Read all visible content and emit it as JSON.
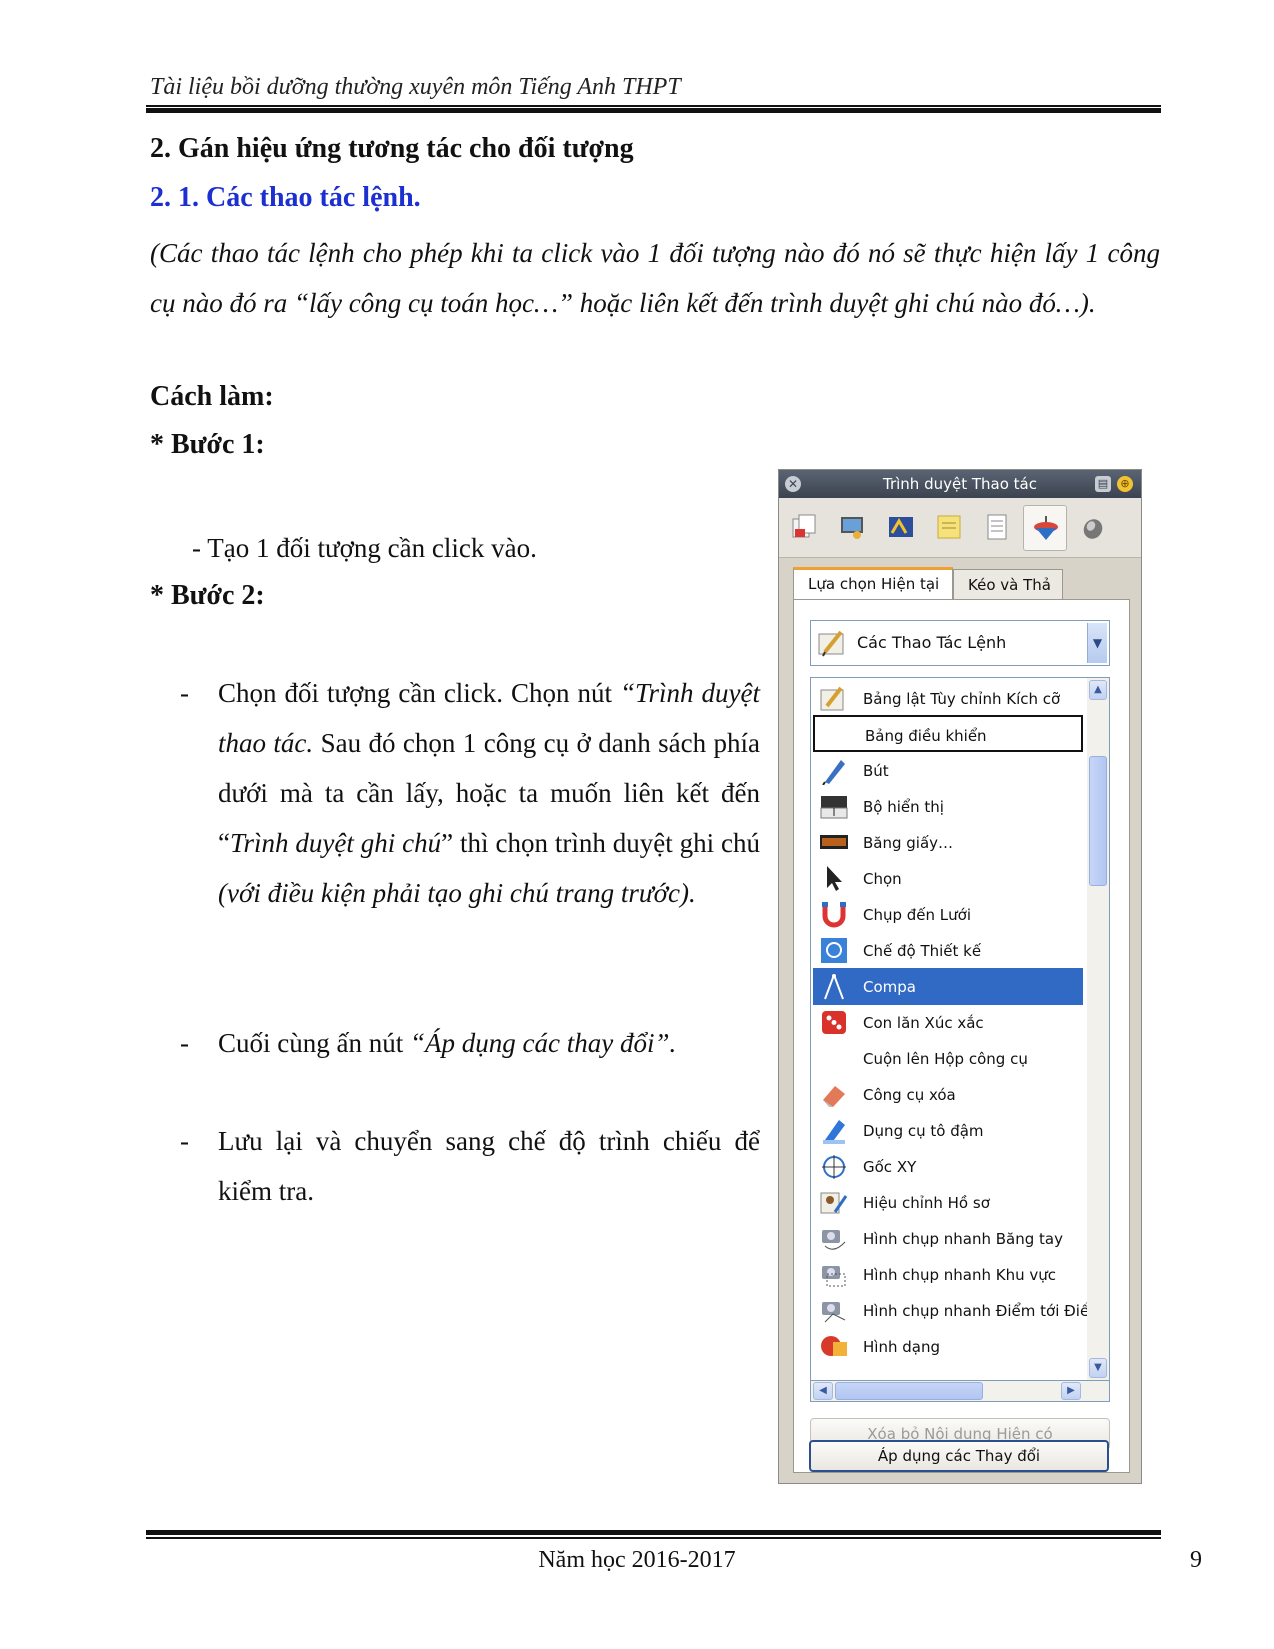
{
  "header": {
    "text": "Tài liệu bồi dưỡng thường xuyên môn Tiếng Anh THPT"
  },
  "section": {
    "title": "2. Gán hiệu ứng tương tác cho đối tượng",
    "subtitle": "2. 1. Các thao tác lệnh.",
    "intro": "(Các thao tác lệnh cho phép khi ta click vào 1 đối tượng nào đó nó sẽ thực hiện lấy 1 công cụ nào đó ra “lấy công cụ toán học…” hoặc liên kết đến trình duyệt ghi chú nào đó…).",
    "how": "Cách làm:",
    "step1": "* Bước 1:",
    "step1_bullet": "- Tạo 1 đối tượng cần click vào.",
    "step2": "* Bước 2:",
    "dash": "-",
    "p1_a": "Chọn đối tượng cần click. Chọn nút ",
    "p1_b": "“Trình duyệt thao tác.",
    "p1_c": " Sau đó chọn 1 công cụ ở danh sách phía dưới mà ta cần lấy, hoặc ta muốn liên kết đến “",
    "p1_d": "Trình duyệt ghi chú",
    "p1_e": "” thì chọn trình duyệt ghi chú ",
    "p1_f": "(với điều kiện phải tạo ghi chú trang trước).",
    "p2_a": "Cuối cùng ấn nút ",
    "p2_b": "“Áp dụng các thay đổi”.",
    "p3": "Lưu lại và chuyển sang chế độ trình chiếu để kiểm tra."
  },
  "panel": {
    "title": "Trình duyệt Thao tác",
    "tabs": [
      "Lựa chọn Hiện tại",
      "Kéo và Thả"
    ],
    "dropdown": {
      "value": "Các Thao Tác Lệnh"
    },
    "items": [
      {
        "label": "Bảng lật Tùy chỉnh Kích cỡ",
        "icon": "pencil-board-icon"
      },
      {
        "label": "Bảng điều khiển",
        "icon": "none"
      },
      {
        "label": "Bút",
        "icon": "pen-icon"
      },
      {
        "label": "Bộ hiển thị",
        "icon": "display-icon"
      },
      {
        "label": "Băng giấy…",
        "icon": "ticker-read-icon"
      },
      {
        "label": "Chọn",
        "icon": "arrow-cursor-icon"
      },
      {
        "label": "Chụp đến Lưới",
        "icon": "magnet-icon"
      },
      {
        "label": "Chế độ Thiết kế",
        "icon": "design-mode-icon"
      },
      {
        "label": "Compa",
        "icon": "compass-icon"
      },
      {
        "label": "Con lăn Xúc xắc",
        "icon": "dice-icon"
      },
      {
        "label": "Cuộn lên Hộp công cụ",
        "icon": "none"
      },
      {
        "label": "Công cụ xóa",
        "icon": "eraser-icon"
      },
      {
        "label": "Dụng cụ tô đậm",
        "icon": "highlighter-icon"
      },
      {
        "label": "Gốc XY",
        "icon": "xy-origin-icon"
      },
      {
        "label": "Hiệu chỉnh Hồ sơ",
        "icon": "profile-icon"
      },
      {
        "label": "Hình chụp nhanh Băng tay",
        "icon": "camera-freehand-icon"
      },
      {
        "label": "Hình chụp nhanh Khu vực",
        "icon": "camera-area-icon"
      },
      {
        "label": "Hình chụp nhanh Điểm tới Điể",
        "icon": "camera-point-icon"
      },
      {
        "label": "Hình dạng",
        "icon": "shape-icon"
      }
    ],
    "buttons": {
      "clear": "Xóa bỏ Nội dung Hiện có",
      "apply": "Áp dụng các Thay đổi"
    }
  },
  "footer": {
    "text": "Năm học 2016-2017",
    "page": "9"
  }
}
